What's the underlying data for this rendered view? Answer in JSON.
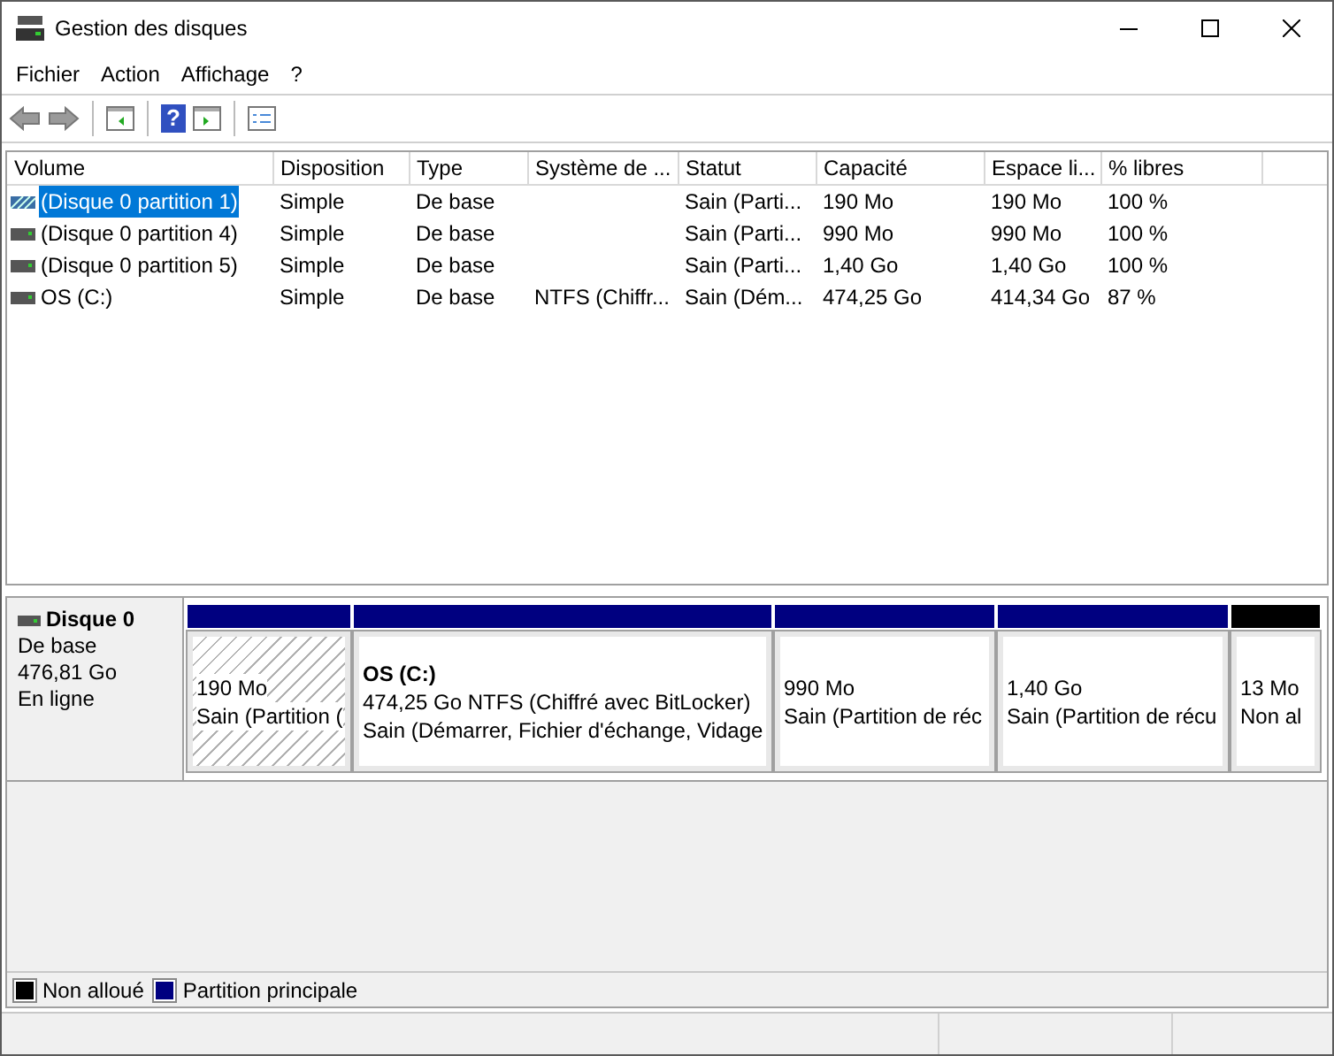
{
  "window": {
    "title": "Gestion des disques"
  },
  "menu": [
    "Fichier",
    "Action",
    "Affichage",
    "?"
  ],
  "toolbar": {
    "help_button": "?"
  },
  "table": {
    "columns": [
      "Volume",
      "Disposition",
      "Type",
      "Système de ...",
      "Statut",
      "Capacité",
      "Espace li...",
      "% libres"
    ],
    "rows": [
      {
        "selected": true,
        "kind": "hatched",
        "cells": [
          "(Disque 0 partition 1)",
          "Simple",
          "De base",
          "",
          "Sain (Parti...",
          "190 Mo",
          "190 Mo",
          "100 %"
        ]
      },
      {
        "selected": false,
        "kind": "drive",
        "cells": [
          "(Disque 0 partition 4)",
          "Simple",
          "De base",
          "",
          "Sain (Parti...",
          "990 Mo",
          "990 Mo",
          "100 %"
        ]
      },
      {
        "selected": false,
        "kind": "drive",
        "cells": [
          "(Disque 0 partition 5)",
          "Simple",
          "De base",
          "",
          "Sain (Parti...",
          "1,40 Go",
          "1,40 Go",
          "100 %"
        ]
      },
      {
        "selected": false,
        "kind": "drive",
        "cells": [
          "OS (C:)",
          "Simple",
          "De base",
          "NTFS (Chiffr...",
          "Sain (Dém...",
          "474,25 Go",
          "414,34 Go",
          "87 %"
        ]
      }
    ]
  },
  "disk": {
    "name": "Disque 0",
    "type": "De base",
    "size": "476,81 Go",
    "status": "En ligne",
    "partitions": [
      {
        "selected": true,
        "color": "#000080",
        "size": "190 Mo",
        "status": "Sain (Partition ("
      },
      {
        "selected": false,
        "color": "#000080",
        "name": "OS  (C:)",
        "size": "474,25 Go NTFS (Chiffré avec BitLocker)",
        "status": "Sain (Démarrer, Fichier d'échange, Vidage"
      },
      {
        "selected": false,
        "color": "#000080",
        "size": "990 Mo",
        "status": "Sain (Partition de réc"
      },
      {
        "selected": false,
        "color": "#000080",
        "size": "1,40 Go",
        "status": "Sain (Partition de récu"
      },
      {
        "selected": false,
        "color": "#000000",
        "size": "13 Mo",
        "status": "Non al"
      }
    ]
  },
  "legend": [
    {
      "color": "#000000",
      "label": "Non alloué"
    },
    {
      "color": "#000080",
      "label": "Partition principale"
    }
  ]
}
